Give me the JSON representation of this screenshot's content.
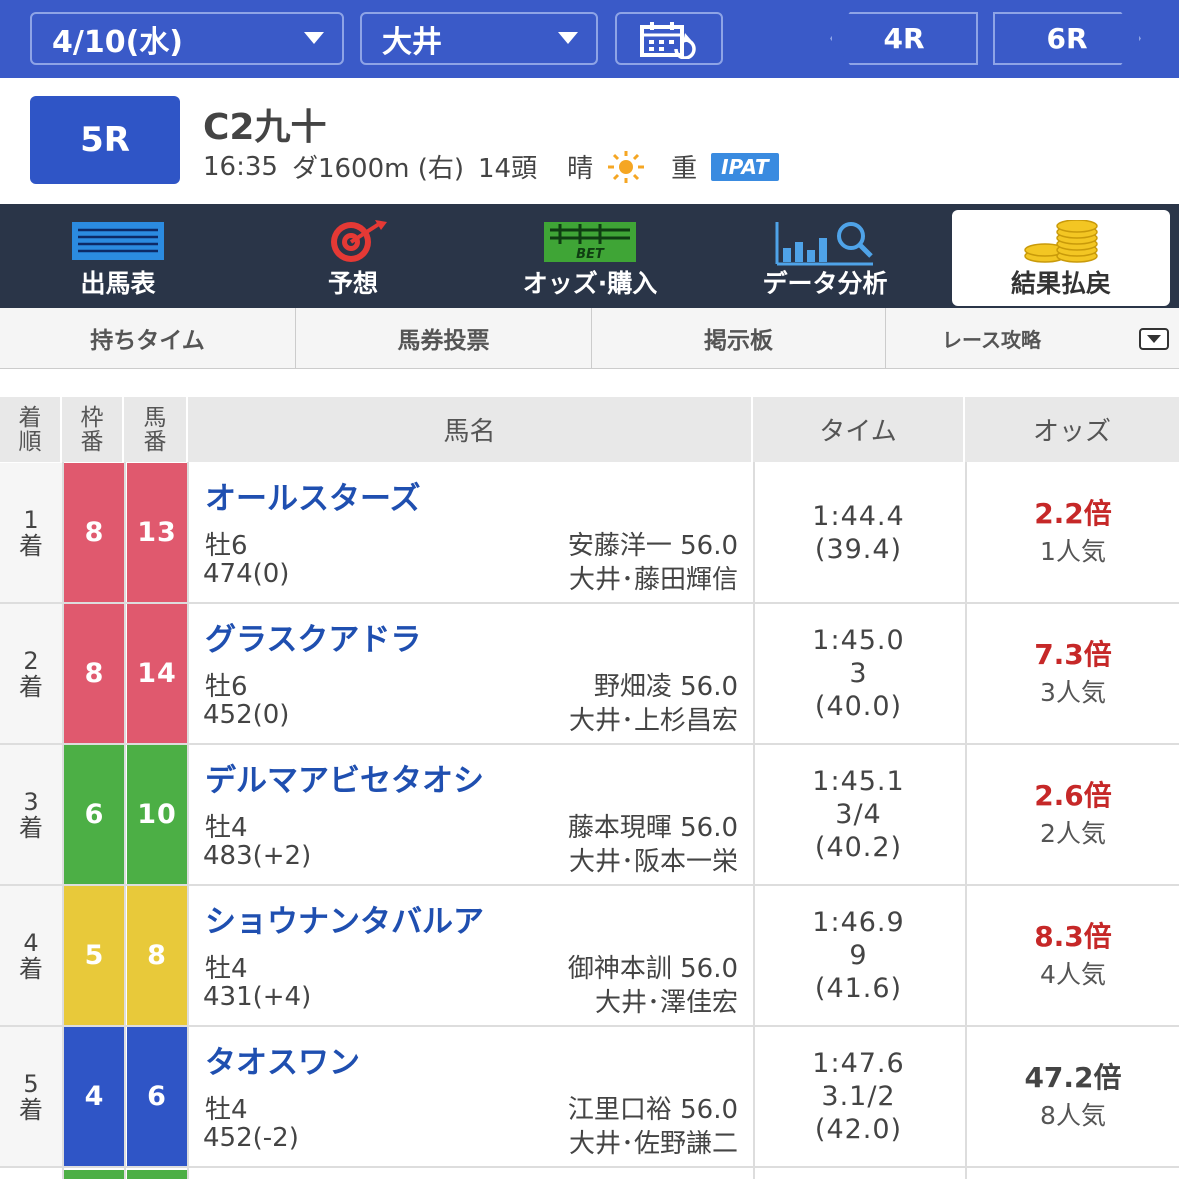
{
  "header": {
    "date": "4/10(水)",
    "venue": "大井",
    "prev_race": "4R",
    "next_race": "6R",
    "calendar_icon": "calendar-refresh-icon"
  },
  "race": {
    "number": "5R",
    "name": "C2九十",
    "start_time": "16:35",
    "course": "ダ1600m (右)",
    "runners": "14頭",
    "weather": "晴",
    "weather_icon": "sun-icon",
    "track": "重",
    "ipat_badge": "IPAT"
  },
  "menu": [
    {
      "label": "出馬表",
      "icon": "race-card-icon"
    },
    {
      "label": "予想",
      "icon": "target-icon"
    },
    {
      "label": "オッズ·購入",
      "icon": "bet-icon"
    },
    {
      "label": "データ分析",
      "icon": "data-chart-icon"
    },
    {
      "label": "結果払戻",
      "icon": "coins-icon",
      "active": true
    }
  ],
  "subnav": [
    "持ちタイム",
    "馬券投票",
    "掲示板",
    "レース攻略"
  ],
  "table": {
    "headers": {
      "finish": [
        "着",
        "順"
      ],
      "frame": [
        "枠",
        "番"
      ],
      "horse_no": [
        "馬",
        "番"
      ],
      "horse_name": "馬名",
      "time": "タイム",
      "odds": "オッズ"
    },
    "rows": [
      {
        "pos": [
          "1",
          "着"
        ],
        "frame": "8",
        "horse_no": "13",
        "name": "オールスターズ",
        "sex_age": "牡6",
        "weight": "474(0)",
        "jockey": "安藤洋一 56.0",
        "trainer": "大井･藤田輝信",
        "time": [
          "1:44.4",
          "(39.4)"
        ],
        "odds": "2.2倍",
        "popularity": "1人気",
        "odds_color": "#c62828",
        "frame_color": "#e0596e",
        "frame_text": "#ffffff"
      },
      {
        "pos": [
          "2",
          "着"
        ],
        "frame": "8",
        "horse_no": "14",
        "name": "グラスクアドラ",
        "sex_age": "牡6",
        "weight": "452(0)",
        "jockey": "野畑凌 56.0",
        "trainer": "大井･上杉昌宏",
        "time": [
          "1:45.0",
          "3",
          "(40.0)"
        ],
        "odds": "7.3倍",
        "popularity": "3人気",
        "odds_color": "#c62828",
        "frame_color": "#e0596e",
        "frame_text": "#ffffff"
      },
      {
        "pos": [
          "3",
          "着"
        ],
        "frame": "6",
        "horse_no": "10",
        "name": "デルマアビセタオシ",
        "sex_age": "牡4",
        "weight": "483(+2)",
        "jockey": "藤本現暉 56.0",
        "trainer": "大井･阪本一栄",
        "time": [
          "1:45.1",
          "3/4",
          "(40.2)"
        ],
        "odds": "2.6倍",
        "popularity": "2人気",
        "odds_color": "#c62828",
        "frame_color": "#4caf45",
        "frame_text": "#ffffff"
      },
      {
        "pos": [
          "4",
          "着"
        ],
        "frame": "5",
        "horse_no": "8",
        "name": "ショウナンタバルア",
        "sex_age": "牡4",
        "weight": "431(+4)",
        "jockey": "御神本訓 56.0",
        "trainer": "大井･澤佳宏",
        "time": [
          "1:46.9",
          "9",
          "(41.6)"
        ],
        "odds": "8.3倍",
        "popularity": "4人気",
        "odds_color": "#c62828",
        "frame_color": "#e8c93a",
        "frame_text": "#ffffff"
      },
      {
        "pos": [
          "5",
          "着"
        ],
        "frame": "4",
        "horse_no": "6",
        "name": "タオスワン",
        "sex_age": "牡4",
        "weight": "452(-2)",
        "jockey": "江里口裕 56.0",
        "trainer": "大井･佐野謙二",
        "time": [
          "1:47.6",
          "3.1/2",
          "(42.0)"
        ],
        "odds": "47.2倍",
        "popularity": "8人気",
        "odds_color": "#444444",
        "frame_color": "#2f55c6",
        "frame_text": "#ffffff"
      }
    ]
  },
  "colors": {
    "brand": "#3a5ac8",
    "menu_bg": "#2a3548",
    "horse_name": "#1f4fb0"
  }
}
